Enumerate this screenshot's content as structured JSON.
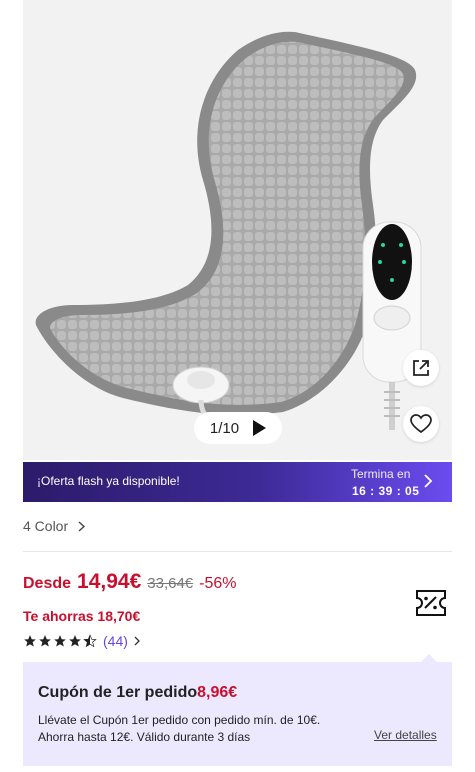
{
  "gallery": {
    "current_index": "1/10",
    "image_alt": "Heating pad with remote controller",
    "icons": [
      "share-icon",
      "heart-icon",
      "play-icon"
    ]
  },
  "flash_banner": {
    "message": "¡Oferta flash ya disponible!",
    "ends_label": "Termina en",
    "timer": "16 : 39 : 05"
  },
  "variants": {
    "label": "4 Color"
  },
  "pricing": {
    "from_label": "Desde",
    "current_price": "14,94€",
    "original_price": "33,64€",
    "discount": "-56%",
    "savings": "Te ahorras 18,70€"
  },
  "rating": {
    "stars": 4.5,
    "review_count": "(44)"
  },
  "coupon": {
    "title": "Cupón de 1er pedido",
    "amount": "8,96€",
    "description": "Llévate el Cupón 1er pedido con pedido mín. de 10€. Ahorra hasta 12€. Válido durante 3 días",
    "details_link": "Ver detalles"
  },
  "colors": {
    "price_red": "#c8102e",
    "accent_purple": "#6548d8",
    "coupon_bg": "#ece9ff"
  }
}
